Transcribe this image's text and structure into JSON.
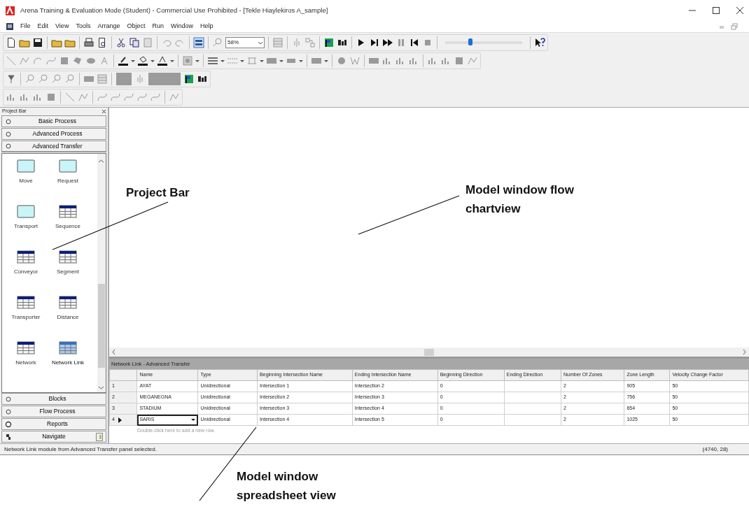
{
  "window": {
    "title": "Arena Training & Evaluation Mode (Student) - Commercial Use Prohibited - [Tekle Hiaylekiros A_sample]"
  },
  "menu": [
    {
      "label": "File"
    },
    {
      "label": "Edit"
    },
    {
      "label": "View"
    },
    {
      "label": "Tools"
    },
    {
      "label": "Arrange"
    },
    {
      "label": "Object"
    },
    {
      "label": "Run"
    },
    {
      "label": "Window"
    },
    {
      "label": "Help"
    }
  ],
  "toolbar": {
    "zoom": "58%",
    "speed_slider": {
      "level": 0.33
    }
  },
  "project_bar": {
    "title": "Project Bar",
    "panels": [
      {
        "label": "Basic Process",
        "kind": "panel",
        "expanded": false
      },
      {
        "label": "Advanced Process",
        "kind": "panel",
        "expanded": false
      },
      {
        "label": "Advanced Transfer",
        "kind": "panel",
        "expanded": true,
        "modules": [
          {
            "label": "Move",
            "kind": "flowchart",
            "selected": false
          },
          {
            "label": "Request",
            "kind": "flowchart",
            "selected": false
          },
          {
            "label": "Transport",
            "kind": "flowchart",
            "selected": false
          },
          {
            "label": "Sequence",
            "kind": "data",
            "selected": false
          },
          {
            "label": "Conveyor",
            "kind": "data",
            "selected": false
          },
          {
            "label": "Segment",
            "kind": "data",
            "selected": false
          },
          {
            "label": "Transporter",
            "kind": "data",
            "selected": false
          },
          {
            "label": "Distance",
            "kind": "data",
            "selected": false
          },
          {
            "label": "Network",
            "kind": "data",
            "selected": false
          },
          {
            "label": "Network Link",
            "kind": "data",
            "selected": true
          }
        ]
      },
      {
        "label": "Blocks",
        "kind": "panel",
        "expanded": false
      },
      {
        "label": "Flow Process",
        "kind": "panel",
        "expanded": false
      },
      {
        "label": "Reports",
        "kind": "reports",
        "expanded": false
      },
      {
        "label": "Navigate",
        "kind": "navigate",
        "expanded": false
      }
    ]
  },
  "spreadsheet": {
    "title": "Network Link - Advanced Transfer",
    "columns": [
      "Name",
      "Type",
      "Beginning Intersection Name",
      "Ending Intersection Name",
      "Beginning Direction",
      "Ending Direction",
      "Number Of Zones",
      "Zone Length",
      "Velocity Change Factor"
    ],
    "rows": [
      {
        "number": "1",
        "selected": false,
        "cells": [
          "AYAT",
          "Unidirectional",
          "Intersection 1",
          "Intersection 2",
          "0",
          null,
          "2",
          "905",
          "50"
        ]
      },
      {
        "number": "2",
        "selected": false,
        "cells": [
          "MEGANEGNA",
          "Unidirectional",
          "Intersection 2",
          "Intersection 3",
          "0",
          null,
          "2",
          "756",
          "50"
        ]
      },
      {
        "number": "3",
        "selected": false,
        "cells": [
          "STADIUM",
          "Unidirectional",
          "Intersection 3",
          "Intersection 4",
          "0",
          null,
          "2",
          "654",
          "50"
        ]
      },
      {
        "number": "4",
        "selected": true,
        "cells": [
          "SARIS",
          "Unidirectional",
          "Intersection 4",
          "Intersection 5",
          "0",
          null,
          "2",
          "1025",
          "50"
        ]
      }
    ],
    "new_row_hint": "Double-click here to add a new row."
  },
  "status_bar": {
    "message": "Network Link module from Advanced Transfer panel selected.",
    "coordinates": "(4740, 28)"
  },
  "annotations": [
    {
      "text": "Project Bar"
    },
    {
      "text": "Model window flow chartview"
    },
    {
      "text": "Model window spreadsheet view"
    }
  ]
}
